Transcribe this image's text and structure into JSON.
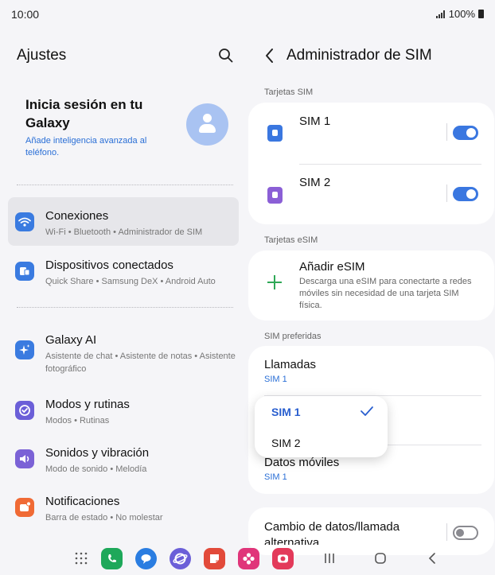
{
  "status_bar": {
    "time": "10:00",
    "battery": "100%"
  },
  "left_pane": {
    "title": "Ajustes",
    "account": {
      "title": "Inicia sesión en tu Galaxy",
      "subtitle": "Añade inteligencia avanzada al teléfono."
    },
    "items": [
      {
        "title": "Conexiones",
        "subtitle": "Wi-Fi  •  Bluetooth  •  Administrador de SIM",
        "icon": "wifi-icon",
        "color": "#3a7be0"
      },
      {
        "title": "Dispositivos conectados",
        "subtitle": "Quick Share  •  Samsung DeX  •  Android Auto",
        "icon": "devices-icon",
        "color": "#3a7be0"
      },
      {
        "title": "Galaxy AI",
        "subtitle": "Asistente de chat  •  Asistente de notas  •  Asistente fotográfico",
        "icon": "sparkle-icon",
        "color": "#3a7be0"
      },
      {
        "title": "Modos y rutinas",
        "subtitle": "Modos  •  Rutinas",
        "icon": "check-circle-icon",
        "color": "#6b5fd8"
      },
      {
        "title": "Sonidos y vibración",
        "subtitle": "Modo de sonido  •  Melodía",
        "icon": "speaker-icon",
        "color": "#7b62d6"
      },
      {
        "title": "Notificaciones",
        "subtitle": "Barra de estado  •  No molestar",
        "icon": "bell-icon",
        "color": "#f06a35"
      }
    ]
  },
  "right_pane": {
    "title": "Administrador de SIM",
    "sim_section_label": "Tarjetas SIM",
    "sims": [
      {
        "label": "SIM 1",
        "enabled": true,
        "color": "#3a77e0"
      },
      {
        "label": "SIM 2",
        "enabled": true,
        "color": "#8b5fd6"
      }
    ],
    "esim_section_label": "Tarjetas eSIM",
    "esim": {
      "title": "Añadir eSIM",
      "description": "Descarga una eSIM para conectarte a redes móviles sin necesidad de una tarjeta SIM física."
    },
    "preferred_section_label": "SIM preferidas",
    "preferred": [
      {
        "title": "Llamadas",
        "value": "SIM 1"
      },
      {
        "title": "Datos móviles",
        "value": "SIM 1"
      }
    ],
    "dropdown": {
      "options": [
        "SIM 1",
        "SIM 2"
      ],
      "selected": "SIM 1"
    },
    "switch_item": {
      "title": "Cambio de datos/llamada alternativa",
      "enabled": false
    }
  },
  "navbar": {
    "apps": [
      {
        "name": "phone-app-icon",
        "color": "#1ea85a"
      },
      {
        "name": "messages-app-icon",
        "color": "#2a7de1"
      },
      {
        "name": "internet-app-icon",
        "color": "#6b5fd8"
      },
      {
        "name": "notes-app-icon",
        "color": "#e24a3a"
      },
      {
        "name": "gallery-app-icon",
        "color": "#e0357a"
      },
      {
        "name": "camera-app-icon",
        "color": "#e33a5a"
      }
    ]
  }
}
